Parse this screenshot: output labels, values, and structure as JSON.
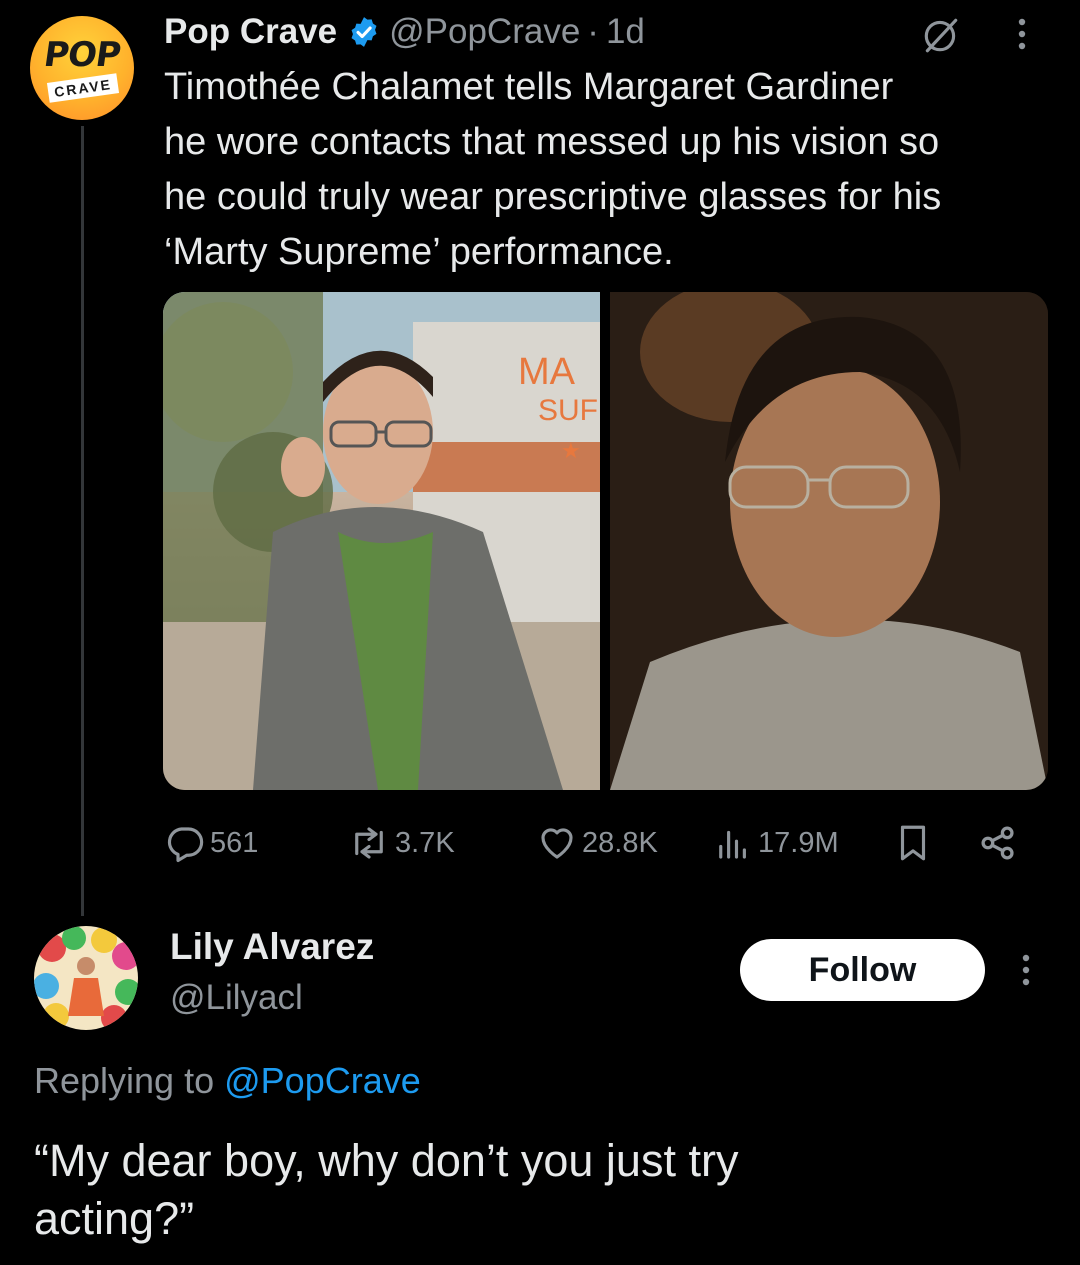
{
  "tweet": {
    "author_name": "Pop Crave",
    "handle": "@PopCrave",
    "separator": "·",
    "time": "1d",
    "avatar": {
      "top_text": "POP",
      "bottom_text": "CRAVE",
      "icon": "pop-crave-logo"
    },
    "text": "Timothée Chalamet tells Margaret Gardiner\nhe wore contacts that messed up his vision so\nhe could truly wear prescriptive glasses for his\n‘Marty Supreme’ performance.",
    "media": [
      {
        "description_icon": "photo-interview",
        "sign_text_1": "MA",
        "sign_text_2": "SUF"
      },
      {
        "description_icon": "photo-film-still"
      }
    ],
    "stats": {
      "replies": "561",
      "reposts": "3.7K",
      "likes": "28.8K",
      "views": "17.9M"
    }
  },
  "reply": {
    "author_name": "Lily Alvarez",
    "handle": "@Lilyacl",
    "follow_label": "Follow",
    "replying_prefix": "Replying to ",
    "replying_to": "@PopCrave",
    "text": "“My dear boy, why don’t you just try\nacting?”"
  },
  "colors": {
    "background": "#000000",
    "text": "#e7e9ea",
    "muted": "#8f959b",
    "link": "#1d9bf0",
    "verified": "#1d9bf0"
  }
}
